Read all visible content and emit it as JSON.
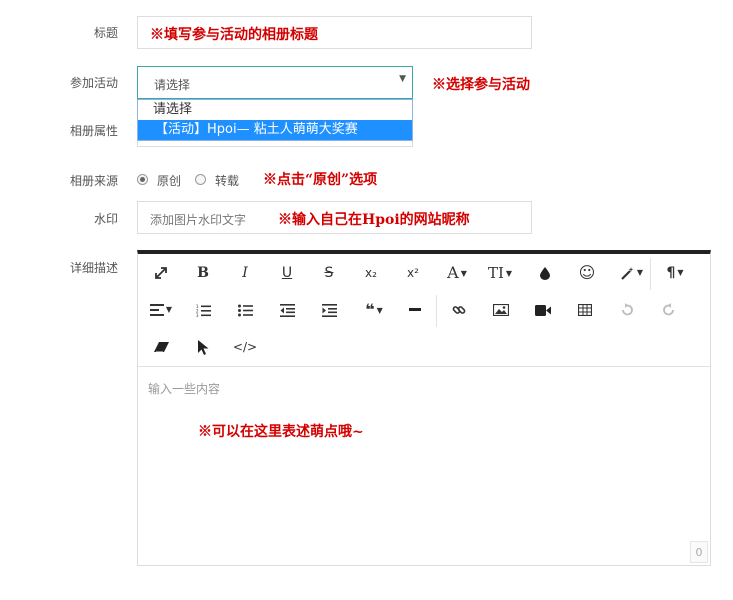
{
  "form": {
    "title_label": "标题",
    "title_annotation": "※填写参与活动的相册标题",
    "activity_label": "参加活动",
    "activity_selected": "请选择",
    "activity_annotation": "※选择参与活动",
    "activity_options": [
      "请选择",
      "【活动】Hpoi— 粘土人萌萌大奖赛"
    ],
    "attribute_label": "相册属性",
    "source_label": "相册来源",
    "source_options": [
      {
        "label": "原创",
        "checked": true
      },
      {
        "label": "转载",
        "checked": false
      }
    ],
    "source_annotation": "※点击“原创”选项",
    "watermark_label": "水印",
    "watermark_placeholder": "添加图片水印文字",
    "watermark_annotation": "※输入自己在Hpoi的网站昵称",
    "description_label": "详细描述"
  },
  "editor": {
    "toolbar_row1": [
      "expand-icon",
      "bold-icon",
      "italic-icon",
      "underline-icon",
      "strikethrough-icon",
      "subscript-icon",
      "superscript-icon",
      "font-color-icon",
      "font-size-icon",
      "ink-drop-icon",
      "smiley-icon",
      "magic-wand-icon",
      "paragraph-icon"
    ],
    "toolbar_row2": [
      "align-icon",
      "ordered-list-icon",
      "unordered-list-icon",
      "outdent-icon",
      "indent-icon",
      "quote-icon",
      "horizontal-rule-icon",
      "link-icon",
      "image-icon",
      "video-icon",
      "table-icon",
      "undo-icon",
      "redo-icon"
    ],
    "toolbar_row3": [
      "eraser-icon",
      "pointer-icon",
      "code-icon"
    ],
    "glyphs": {
      "bold": "B",
      "italic": "I",
      "underline": "U",
      "strike": "S",
      "sub": "x₂",
      "sup": "x²",
      "fontcolor": "A",
      "fontsize": "TI",
      "paragraph": "¶",
      "quote": "❝",
      "code": "</>",
      "smile": "☺"
    },
    "placeholder": "输入一些内容",
    "annotation": "※可以在这里表述萌点哦~",
    "char_count": "0"
  }
}
